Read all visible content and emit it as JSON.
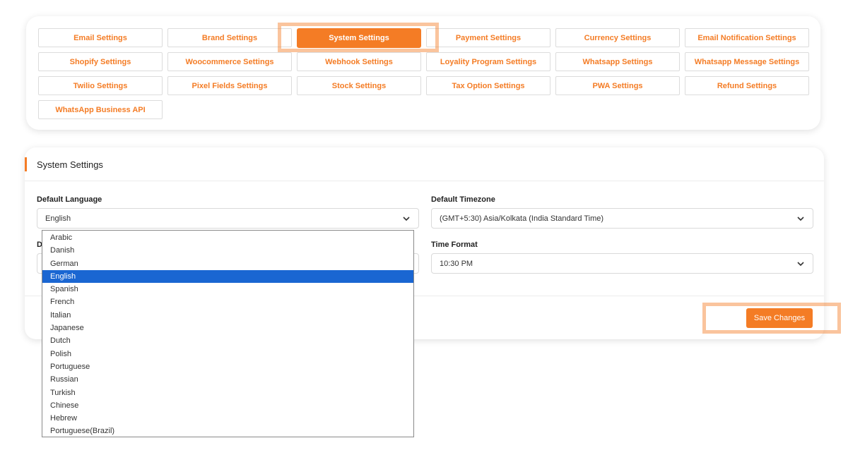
{
  "tabs": [
    {
      "label": "Email Settings",
      "active": false
    },
    {
      "label": "Brand Settings",
      "active": false
    },
    {
      "label": "System Settings",
      "active": true
    },
    {
      "label": "Payment Settings",
      "active": false
    },
    {
      "label": "Currency Settings",
      "active": false
    },
    {
      "label": "Email Notification Settings",
      "active": false
    },
    {
      "label": "Shopify Settings",
      "active": false
    },
    {
      "label": "Woocommerce Settings",
      "active": false
    },
    {
      "label": "Webhook Settings",
      "active": false
    },
    {
      "label": "Loyality Program Settings",
      "active": false
    },
    {
      "label": "Whatsapp Settings",
      "active": false
    },
    {
      "label": "Whatsapp Message Settings",
      "active": false
    },
    {
      "label": "Twilio Settings",
      "active": false
    },
    {
      "label": "Pixel Fields Settings",
      "active": false
    },
    {
      "label": "Stock Settings",
      "active": false
    },
    {
      "label": "Tax Option Settings",
      "active": false
    },
    {
      "label": "PWA Settings",
      "active": false
    },
    {
      "label": "Refund Settings",
      "active": false
    },
    {
      "label": "WhatsApp Business API",
      "active": false
    }
  ],
  "settings": {
    "title": "System Settings",
    "default_language": {
      "label": "Default Language",
      "value": "English"
    },
    "default_timezone": {
      "label": "Default Timezone",
      "value": "(GMT+5:30) Asia/Kolkata (India Standard Time)"
    },
    "date_format": {
      "label_visible": "D"
    },
    "time_format": {
      "label": "Time Format",
      "value": "10:30 PM"
    },
    "save_label": "Save Changes"
  },
  "language_options": [
    "Arabic",
    "Danish",
    "German",
    "English",
    "Spanish",
    "French",
    "Italian",
    "Japanese",
    "Dutch",
    "Polish",
    "Portuguese",
    "Russian",
    "Turkish",
    "Chinese",
    "Hebrew",
    "Portuguese(Brazil)"
  ],
  "selected_language": "English",
  "colors": {
    "accent": "#f47c25",
    "selected_option": "#1a66d2"
  }
}
